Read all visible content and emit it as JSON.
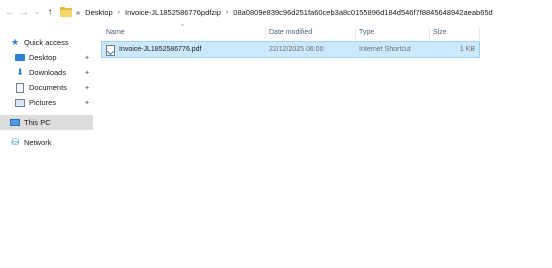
{
  "nav": {
    "back_icon": "arrow-left-icon",
    "forward_icon": "arrow-right-icon",
    "recent_icon": "chevron-down-icon",
    "up_icon": "arrow-up-icon"
  },
  "address": {
    "overflow": "«",
    "crumbs": [
      "Desktop",
      "Invoice-JL1852586776pdfzip",
      "08a0809e839c96d251fa60ceb3a8c0155896d184d546f7f8845648942aeab65d"
    ]
  },
  "sidebar": {
    "items": [
      {
        "label": "Quick access",
        "icon": "star-icon"
      },
      {
        "label": "Desktop",
        "icon": "desktop-icon",
        "pinned": true
      },
      {
        "label": "Downloads",
        "icon": "download-icon",
        "pinned": true
      },
      {
        "label": "Documents",
        "icon": "document-icon",
        "pinned": true
      },
      {
        "label": "Pictures",
        "icon": "pictures-icon",
        "pinned": true
      },
      {
        "label": "This PC",
        "icon": "computer-icon",
        "selected": true
      },
      {
        "label": "Network",
        "icon": "network-icon"
      }
    ]
  },
  "columns": {
    "name": "Name",
    "date_modified": "Date modified",
    "type": "Type",
    "size": "Size"
  },
  "files": [
    {
      "name": "Invoice-JL1852586776.pdf",
      "date_modified": "22/12/2025 06:00",
      "type": "Internet Shortcut",
      "size": "1 KB"
    }
  ],
  "colors": {
    "selection": "#cce8ff",
    "selection_border": "#99d1ff",
    "folder": "#e8b93b"
  }
}
